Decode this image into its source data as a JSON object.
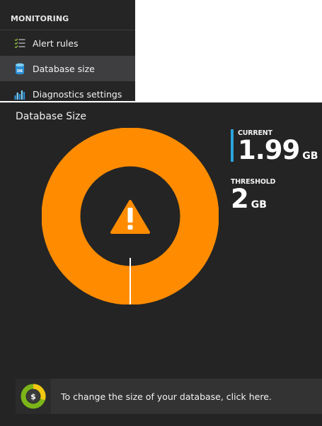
{
  "nav": {
    "header": "MONITORING",
    "items": [
      {
        "label": "Alert rules",
        "icon": "list-check-icon",
        "selected": false
      },
      {
        "label": "Database size",
        "icon": "database-icon",
        "selected": true
      },
      {
        "label": "Diagnostics settings",
        "icon": "bar-chart-icon",
        "selected": false
      }
    ]
  },
  "panel": {
    "title": "Database Size",
    "current": {
      "label": "CURRENT",
      "value": "1.99",
      "unit": "GB"
    },
    "threshold": {
      "label": "THRESHOLD",
      "value": "2",
      "unit": "GB"
    },
    "usage_fraction": 0.995,
    "colors": {
      "ring": "#ff8c00",
      "ring_marker": "#ffffff",
      "warning_icon": "#ff8c00",
      "accent": "#2aa4dc"
    },
    "notice": {
      "text": "To change the size of your database, click here.",
      "icon": "pricing-tier-icon"
    }
  }
}
